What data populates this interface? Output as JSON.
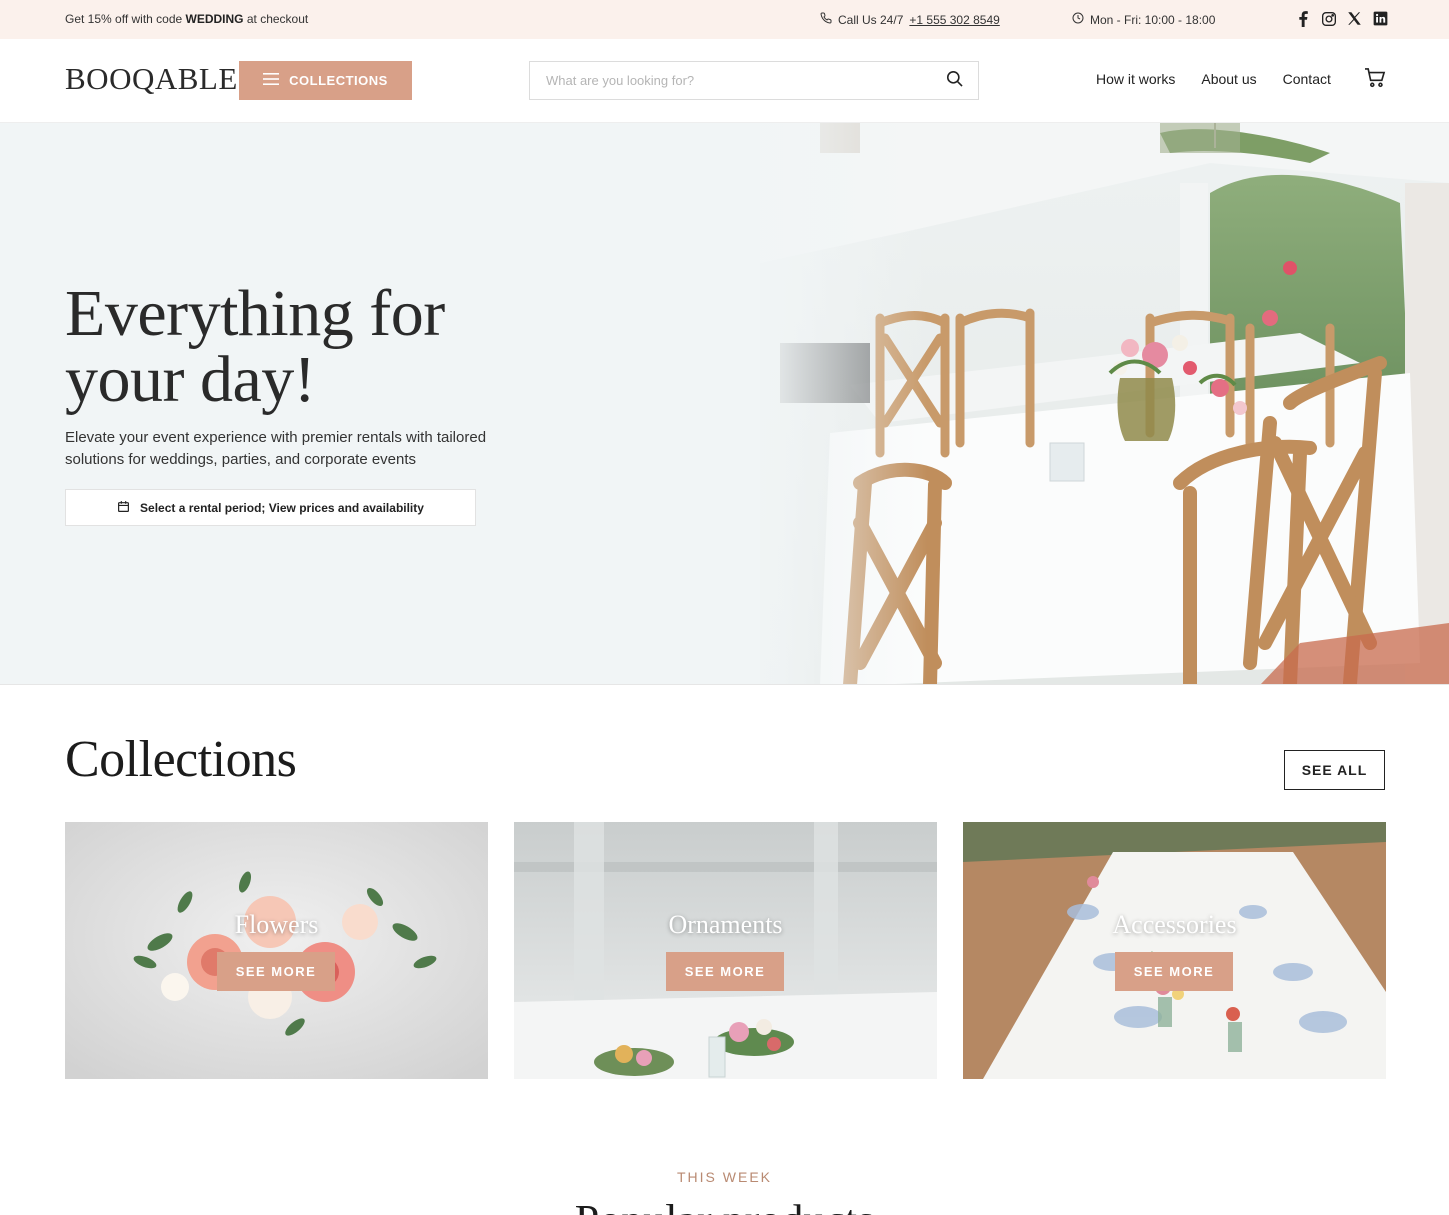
{
  "topbar": {
    "promo_prefix": "Get 15% off with code ",
    "promo_code": "WEDDING",
    "promo_suffix": " at checkout",
    "call_label": "Call Us 24/7",
    "call_number": "+1 555 302 8549",
    "hours": "Mon - Fri: 10:00 - 18:00",
    "social": [
      "facebook-icon",
      "instagram-icon",
      "x-icon",
      "linkedin-icon"
    ]
  },
  "header": {
    "logo": "BOOQABLE",
    "collections_label": "COLLECTIONS",
    "search_placeholder": "What are you looking for?",
    "nav": [
      "How it works",
      "About us",
      "Contact"
    ]
  },
  "hero": {
    "title": "Everything for your day!",
    "subtitle": "Elevate your event experience with premier rentals with tailored solutions for weddings, parties, and corporate events",
    "period_button": "Select a rental period; View prices and availability"
  },
  "collections": {
    "title": "Collections",
    "see_all": "SEE ALL",
    "items": [
      {
        "label": "Flowers",
        "cta": "SEE MORE"
      },
      {
        "label": "Ornaments",
        "cta": "SEE MORE"
      },
      {
        "label": "Accessories",
        "cta": "SEE MORE"
      }
    ]
  },
  "this_week": {
    "eyebrow": "THIS WEEK",
    "title": "Popular products"
  },
  "colors": {
    "accent": "#d8a088",
    "topbar_bg": "#fbf1ec",
    "eyebrow": "#b98a72"
  }
}
